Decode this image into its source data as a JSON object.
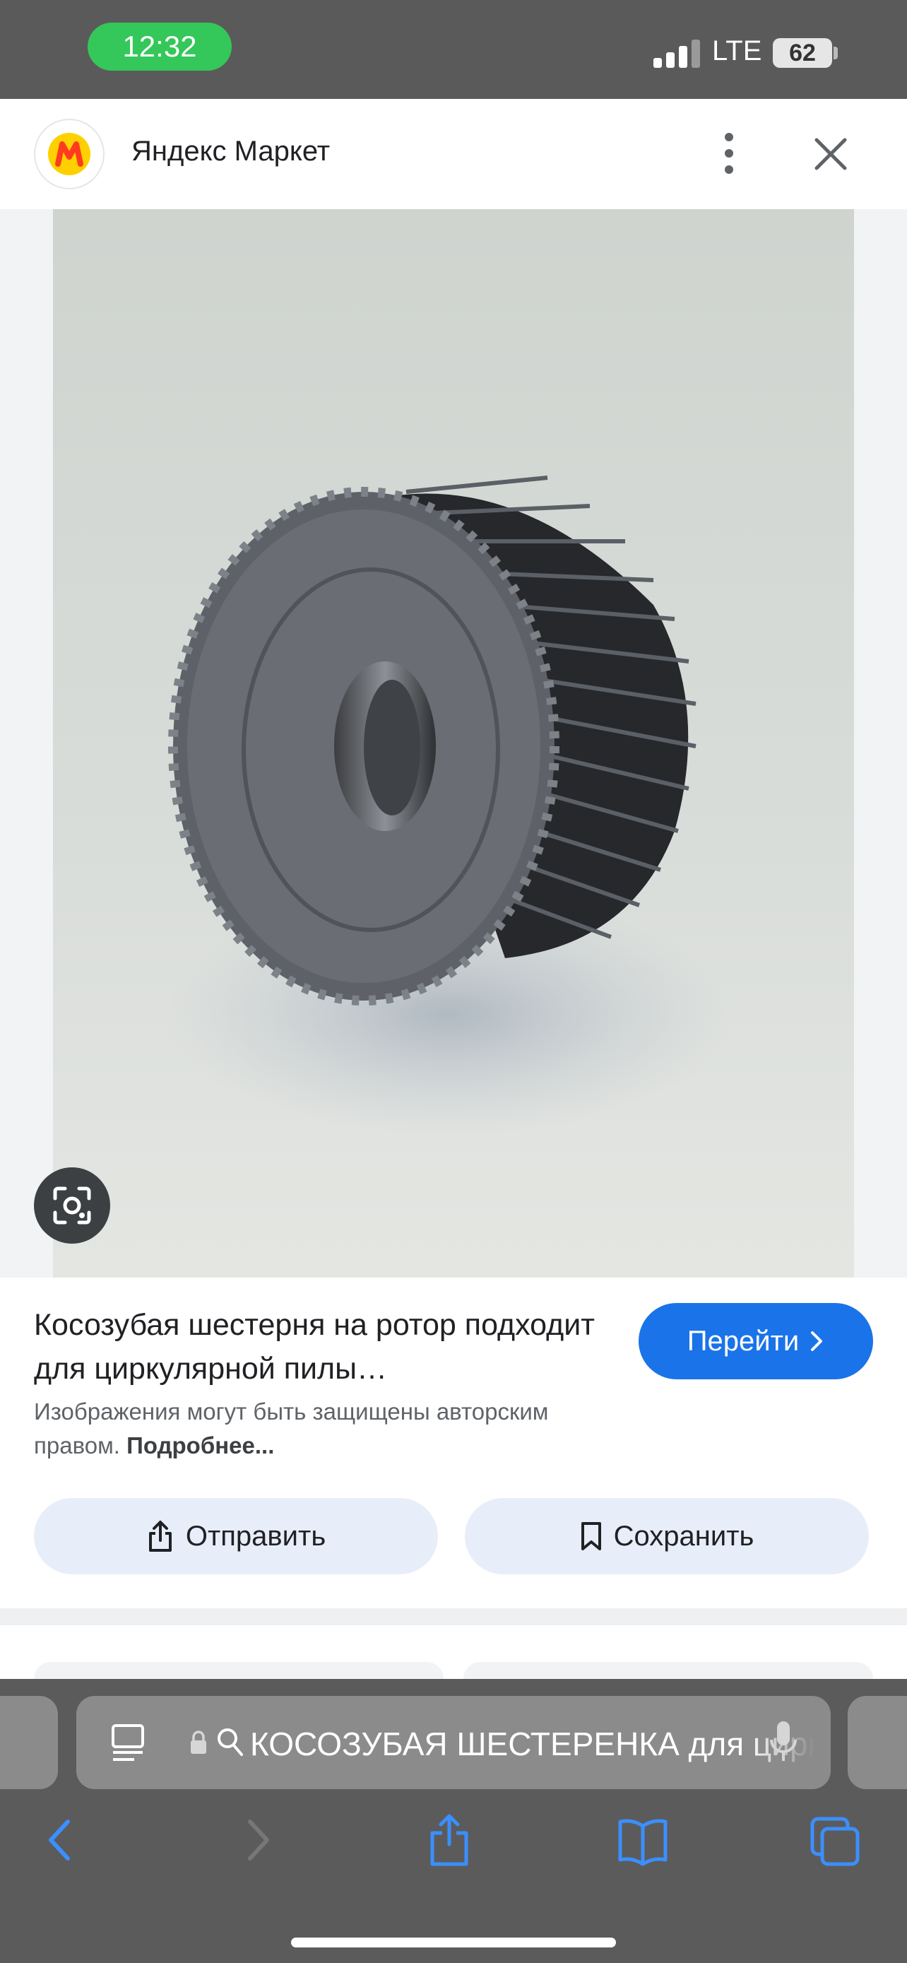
{
  "status_bar": {
    "time": "12:32",
    "network": "LTE",
    "battery": "62"
  },
  "header": {
    "site_name": "Яндекс Маркет"
  },
  "result": {
    "title": "Косозубая шестерня на ротор подходит для циркулярной пилы…",
    "go_button": "Перейти",
    "copyright": "Изображения могут быть защищены авторским правом.",
    "more_link": "Подробнее...",
    "share_button": "Отправить",
    "save_button": "Сохранить"
  },
  "browser": {
    "address": "КОСОЗУБАЯ ШЕСТЕРЕНКА для циркулярной пилы"
  },
  "colors": {
    "accent": "#1a73e8",
    "status_pill": "#34c759",
    "brand_yellow": "#ffd000",
    "brand_red": "#ff3b1f"
  }
}
